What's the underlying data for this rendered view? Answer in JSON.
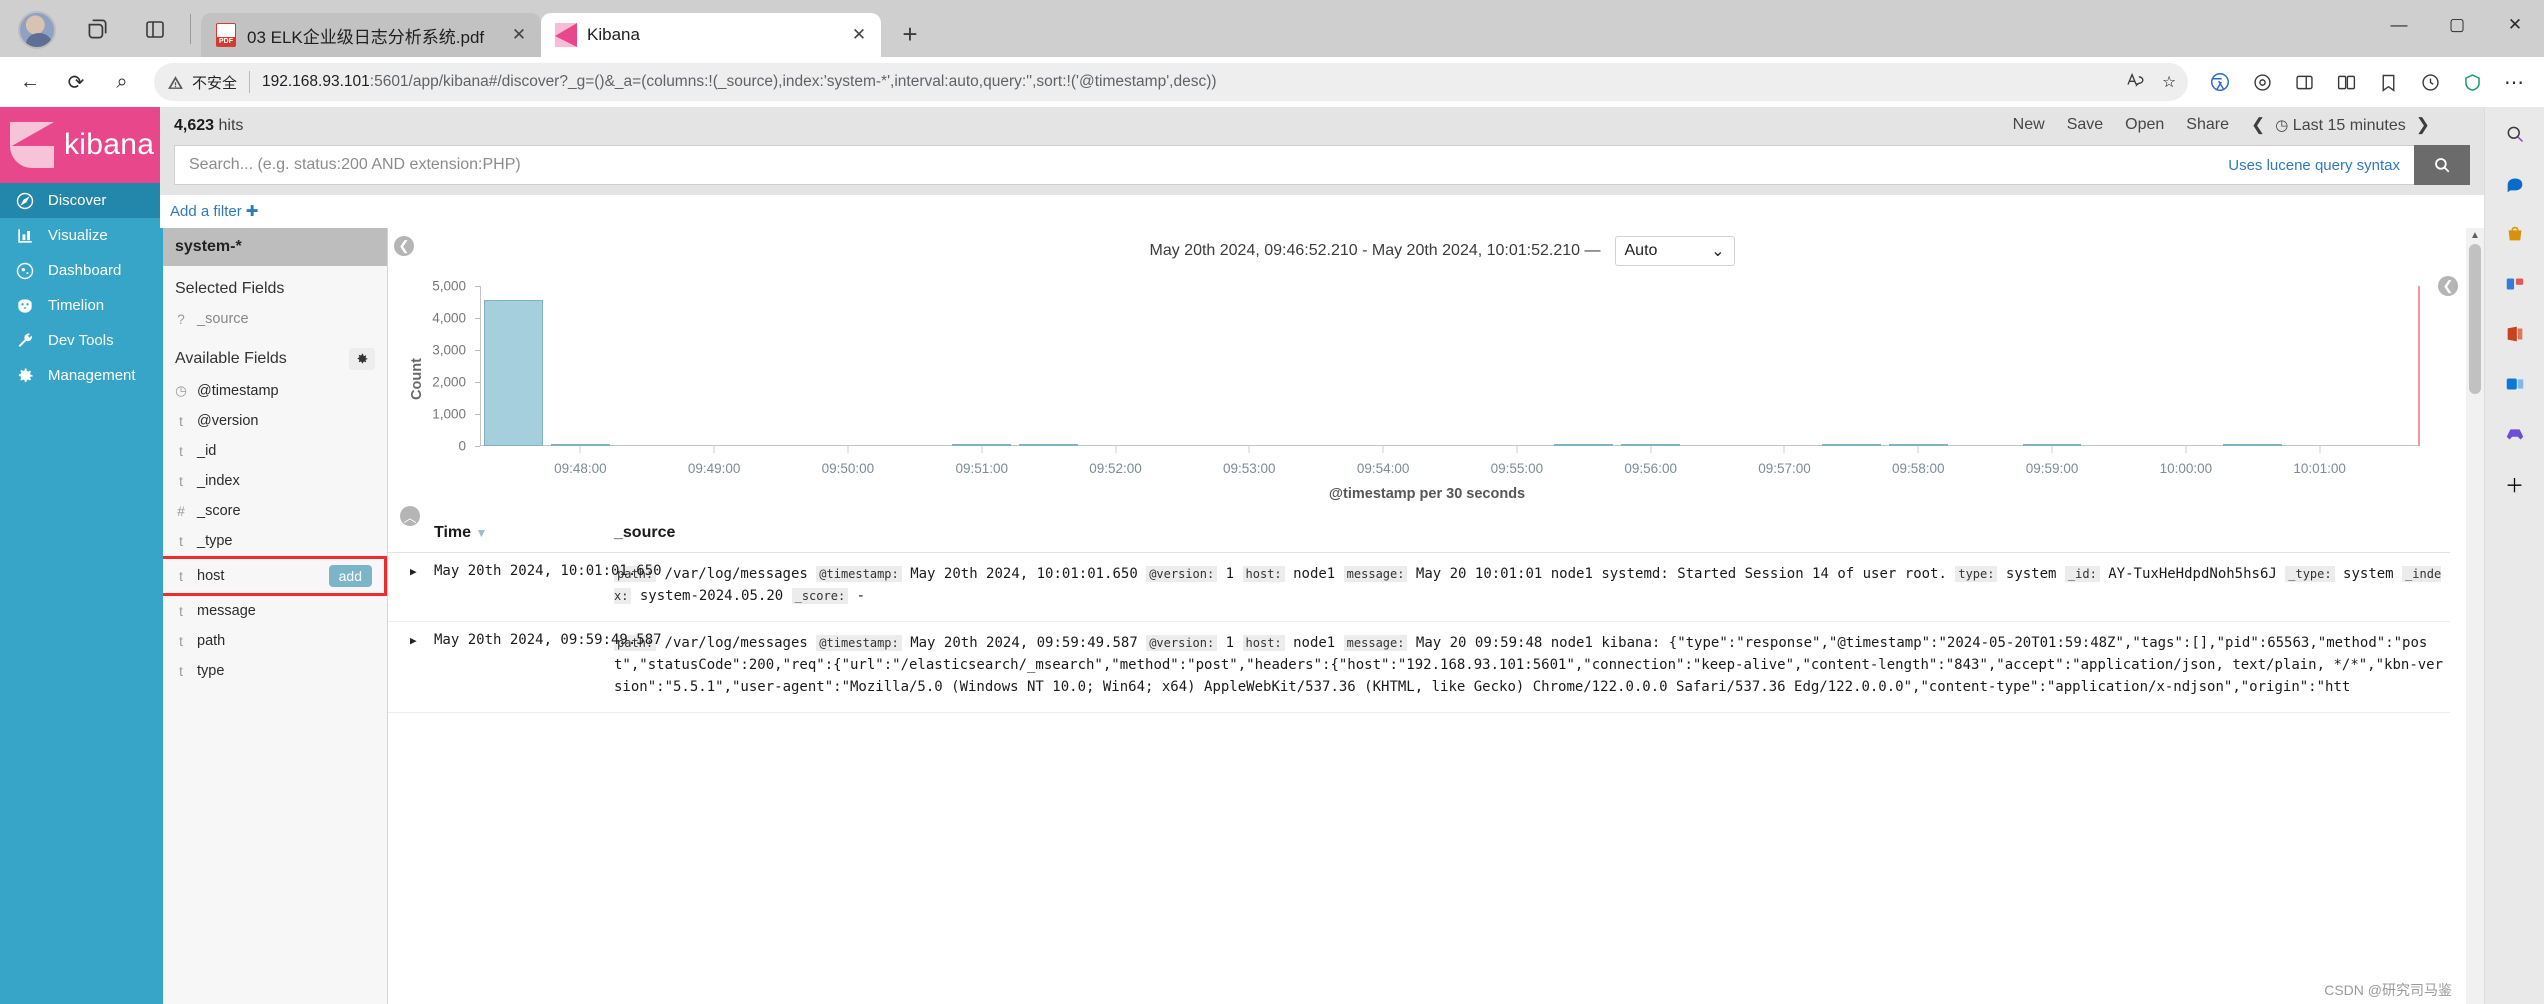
{
  "browser": {
    "tabs": [
      {
        "title": "03 ELK企业级日志分析系统.pdf",
        "favicon": "pdf-icon",
        "active": false,
        "close": "✕"
      },
      {
        "title": "Kibana",
        "favicon": "kibana-icon",
        "active": true,
        "close": "✕"
      }
    ],
    "new_tab_label": "+",
    "window_controls": {
      "minimize": "—",
      "maximize": "▢",
      "close": "✕"
    },
    "nav": {
      "back": "←",
      "reload": "⟳",
      "search": "⌕"
    },
    "omnibox": {
      "security_label": "不安全",
      "security_icon": "warning-triangle-icon",
      "url_host": "192.168.93.101",
      "url_rest": ":5601/app/kibana#/discover?_g=()&_a=(columns:!(_source),index:'system-*',interval:auto,query:'',sort:!('@timestamp',desc))",
      "read_aloud": "A𝅘",
      "favorite": "☆"
    },
    "toolbar_icons": [
      "extensions-icon",
      "collections-icon",
      "split-screen-icon",
      "favorites-icon",
      "history-icon",
      "browser-essentials-icon",
      "settings-more-icon"
    ],
    "rail_icons": [
      "search-icon",
      "copilot-icon",
      "shopping-icon",
      "tools-icon",
      "office-icon",
      "outlook-icon",
      "games-icon",
      "add-icon"
    ]
  },
  "kibana": {
    "logo_text": "kibana",
    "nav_items": [
      {
        "label": "Discover",
        "icon": "compass-icon",
        "active": true
      },
      {
        "label": "Visualize",
        "icon": "bar-chart-icon",
        "active": false
      },
      {
        "label": "Dashboard",
        "icon": "dashboard-icon",
        "active": false
      },
      {
        "label": "Timelion",
        "icon": "timelion-icon",
        "active": false
      },
      {
        "label": "Dev Tools",
        "icon": "wrench-icon",
        "active": false
      },
      {
        "label": "Management",
        "icon": "gear-icon",
        "active": false
      }
    ],
    "topbar": {
      "hits_count": "4,623",
      "hits_label": " hits",
      "actions": [
        "New",
        "Save",
        "Open",
        "Share"
      ],
      "time_prev": "❮",
      "time_next": "❯",
      "time_icon": "clock-icon",
      "time_range": "Last 15 minutes"
    },
    "search": {
      "placeholder": "Search... (e.g. status:200 AND extension:PHP)",
      "value": "",
      "syntax_hint": "Uses lucene query syntax",
      "submit_icon": "search-icon"
    },
    "filter_bar": {
      "add_filter": "Add a filter ✚"
    },
    "fields_panel": {
      "index_pattern": "system-*",
      "selected_heading": "Selected Fields",
      "selected_fields": [
        {
          "type": "?",
          "name": "_source"
        }
      ],
      "available_heading": "Available Fields",
      "settings_icon": "gear-icon",
      "available_fields": [
        {
          "type": "◷",
          "name": "@timestamp",
          "highlight": false
        },
        {
          "type": "t",
          "name": "@version",
          "highlight": false
        },
        {
          "type": "t",
          "name": "_id",
          "highlight": false
        },
        {
          "type": "t",
          "name": "_index",
          "highlight": false
        },
        {
          "type": "#",
          "name": "_score",
          "highlight": false
        },
        {
          "type": "t",
          "name": "_type",
          "highlight": false
        },
        {
          "type": "t",
          "name": "host",
          "highlight": true,
          "add_label": "add"
        },
        {
          "type": "t",
          "name": "message",
          "highlight": false
        },
        {
          "type": "t",
          "name": "path",
          "highlight": false
        },
        {
          "type": "t",
          "name": "type",
          "highlight": false
        }
      ]
    },
    "chart_header": {
      "range_text": "May 20th 2024, 09:46:52.210 - May 20th 2024, 10:01:52.210 —",
      "interval_value": "Auto",
      "interval_caret": "⌄"
    },
    "collapse_left_icon": "❮",
    "collapse_right_icon": "❮",
    "collapse_up_icon": "︿",
    "table": {
      "columns": [
        "Time",
        "_source"
      ],
      "sort_icon": "▼",
      "rows": [
        {
          "expander": "▶",
          "time": "May 20th 2024, 10:01:01.650",
          "source_pairs": [
            {
              "key": "path:",
              "value": "/var/log/messages"
            },
            {
              "key": "@timestamp:",
              "value": "May 20th 2024, 10:01:01.650"
            },
            {
              "key": "@version:",
              "value": "1"
            },
            {
              "key": "host:",
              "value": "node1"
            },
            {
              "key": "message:",
              "value": "May 20 10:01:01 node1 systemd: Started Session 14 of user root."
            },
            {
              "key": "type:",
              "value": "system"
            },
            {
              "key": "_id:",
              "value": "AY-TuxHeHdpdNoh5hs6J"
            },
            {
              "key": "_type:",
              "value": "system"
            },
            {
              "key": "_index:",
              "value": "system-2024.05.20"
            },
            {
              "key": "_score:",
              "value": "-"
            }
          ]
        },
        {
          "expander": "▶",
          "time": "May 20th 2024, 09:59:49.587",
          "source_pairs": [
            {
              "key": "path:",
              "value": "/var/log/messages"
            },
            {
              "key": "@timestamp:",
              "value": "May 20th 2024, 09:59:49.587"
            },
            {
              "key": "@version:",
              "value": "1"
            },
            {
              "key": "host:",
              "value": "node1"
            },
            {
              "key": "message:",
              "value": "May 20 09:59:48 node1 kibana: {\"type\":\"response\",\"@timestamp\":\"2024-05-20T01:59:48Z\",\"tags\":[],\"pid\":65563,\"method\":\"post\",\"statusCode\":200,\"req\":{\"url\":\"/elasticsearch/_msearch\",\"method\":\"post\",\"headers\":{\"host\":\"192.168.93.101:5601\",\"connection\":\"keep-alive\",\"content-length\":\"843\",\"accept\":\"application/json, text/plain, */*\",\"kbn-version\":\"5.5.1\",\"user-agent\":\"Mozilla/5.0 (Windows NT 10.0; Win64; x64) AppleWebKit/537.36 (KHTML, like Gecko) Chrome/122.0.0.0 Safari/537.36 Edg/122.0.0.0\",\"content-type\":\"application/x-ndjson\",\"origin\":\"htt"
            }
          ]
        }
      ]
    },
    "watermark": "CSDN @研究司马鉴"
  },
  "chart_data": {
    "type": "bar",
    "title": "",
    "xlabel": "@timestamp per 30 seconds",
    "ylabel": "Count",
    "ylim": [
      0,
      5000
    ],
    "yticks": [
      0,
      1000,
      2000,
      3000,
      4000,
      5000
    ],
    "ytick_labels": [
      "0",
      "1,000",
      "2,000",
      "3,000",
      "4,000",
      "5,000"
    ],
    "xticks": [
      "09:48:00",
      "09:49:00",
      "09:50:00",
      "09:51:00",
      "09:52:00",
      "09:53:00",
      "09:54:00",
      "09:55:00",
      "09:56:00",
      "09:57:00",
      "09:58:00",
      "09:59:00",
      "10:00:00",
      "10:01:00"
    ],
    "interval_seconds": 30,
    "bar_color": "#a5cfdd",
    "bar_border_color": "#7fb3c4",
    "now_marker_color": "#eb9b9b",
    "grid": false,
    "legend": false,
    "categories": [
      "09:47:30",
      "09:48:00",
      "09:48:30",
      "09:49:00",
      "09:49:30",
      "09:50:00",
      "09:50:30",
      "09:51:00",
      "09:51:30",
      "09:52:00",
      "09:52:30",
      "09:53:00",
      "09:53:30",
      "09:54:00",
      "09:54:30",
      "09:55:00",
      "09:55:30",
      "09:56:00",
      "09:56:30",
      "09:57:00",
      "09:57:30",
      "09:58:00",
      "09:58:30",
      "09:59:00",
      "09:59:30",
      "10:00:00",
      "10:00:30",
      "10:01:00",
      "10:01:30"
    ],
    "values": [
      4550,
      20,
      0,
      0,
      0,
      0,
      0,
      15,
      15,
      0,
      0,
      0,
      0,
      0,
      0,
      0,
      25,
      20,
      0,
      0,
      30,
      20,
      0,
      18,
      0,
      0,
      18,
      0,
      0
    ]
  }
}
